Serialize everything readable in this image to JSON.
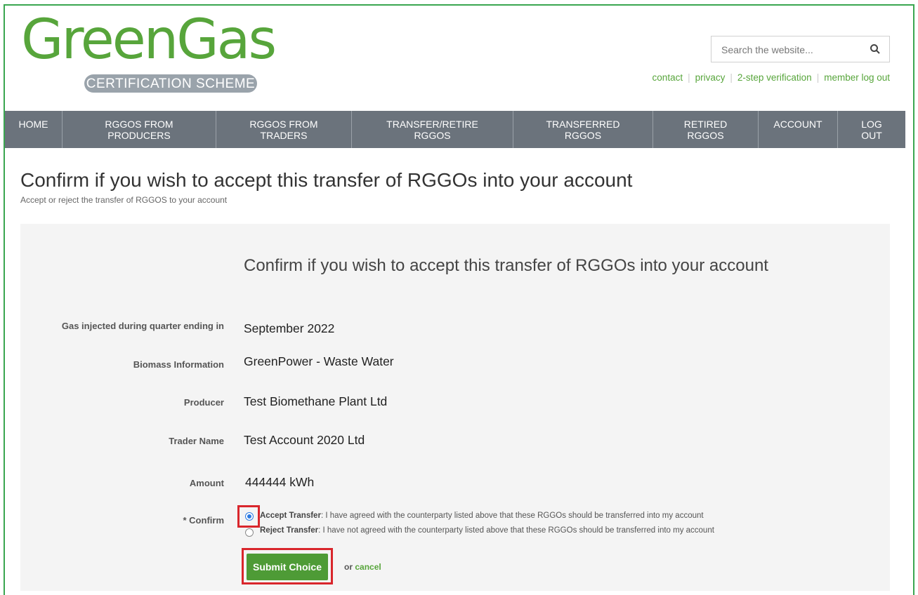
{
  "logo": {
    "word": "GreenGas",
    "tagline": "CERTIFICATION SCHEME"
  },
  "search": {
    "placeholder": "Search the website..."
  },
  "toplinks": [
    "contact",
    "privacy",
    "2-step verification",
    "member log out"
  ],
  "nav": [
    {
      "label": "HOME",
      "width": 82
    },
    {
      "label": "RGGOS FROM\nPRODUCERS",
      "width": 219
    },
    {
      "label": "RGGOS FROM\nTRADERS",
      "width": 193
    },
    {
      "label": "TRANSFER/RETIRE\nRGGOS",
      "width": 230
    },
    {
      "label": "TRANSFERRED\nRGGOS",
      "width": 199
    },
    {
      "label": "RETIRED\nRGGOS",
      "width": 150
    },
    {
      "label": "ACCOUNT",
      "width": 113
    },
    {
      "label": "LOG\nOUT",
      "width": 96
    }
  ],
  "page": {
    "title": "Confirm if you wish to accept this transfer of RGGOs into your account",
    "subtitle": "Accept or reject the transfer of RGGOS to your account"
  },
  "form": {
    "title": "Confirm if you wish to accept this transfer of RGGOs into your account",
    "fields": [
      {
        "label": "Gas injected during quarter ending in",
        "value": "September 2022"
      },
      {
        "label": "Biomass Information",
        "value": "GreenPower - Waste Water"
      },
      {
        "label": "Producer",
        "value": "Test Biomethane Plant Ltd"
      },
      {
        "label": "Trader Name",
        "value": "Test Account 2020 Ltd"
      },
      {
        "label": "Amount",
        "value": "444444 kWh"
      }
    ],
    "confirm_label": "* Confirm",
    "accept_title": "Accept Transfer",
    "accept_text": ": I have agreed with the counterparty listed above that these RGGOs should be transferred into my account",
    "reject_title": "Reject Transfer",
    "reject_text": ": I have not agreed with the counterparty listed above that these RGGOs should be transferred into my account",
    "submit_label": "Submit Choice",
    "or_text": "or ",
    "cancel_label": "cancel"
  }
}
